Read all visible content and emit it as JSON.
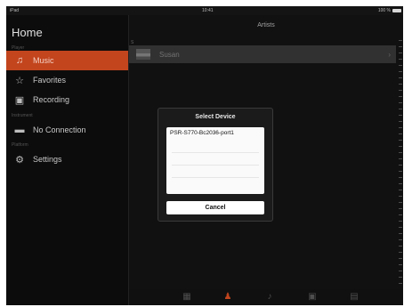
{
  "status_bar": {
    "left": "iPad",
    "time": "10:41",
    "battery": "100 %"
  },
  "sidebar": {
    "title": "Home",
    "sections": {
      "player": "Player",
      "instrument": "Instrument",
      "platform": "Platform"
    },
    "items": [
      {
        "label": "Music",
        "icon": "music-note-icon",
        "active": true
      },
      {
        "label": "Favorites",
        "icon": "star-icon",
        "active": false
      },
      {
        "label": "Recording",
        "icon": "recording-icon",
        "active": false
      },
      {
        "label": "No Connection",
        "icon": "keyboard-icon",
        "active": false
      },
      {
        "label": "Settings",
        "icon": "gear-icon",
        "active": false
      }
    ]
  },
  "main": {
    "header": "Artists",
    "index_letter": "S",
    "rows": [
      {
        "name": "Susan",
        "chevron": "›"
      }
    ]
  },
  "dialog": {
    "title": "Select Device",
    "devices": [
      "PSR-S770-Bc2036-port1"
    ],
    "cancel": "Cancel"
  },
  "tabbar": {
    "tabs": [
      {
        "icon": "grid-icon",
        "active": false
      },
      {
        "icon": "person-icon",
        "active": true
      },
      {
        "icon": "note-icon",
        "active": false
      },
      {
        "icon": "album-icon",
        "active": false
      },
      {
        "icon": "list-icon",
        "active": false
      }
    ]
  },
  "colors": {
    "accent": "#c2451e",
    "background": "#141414"
  }
}
